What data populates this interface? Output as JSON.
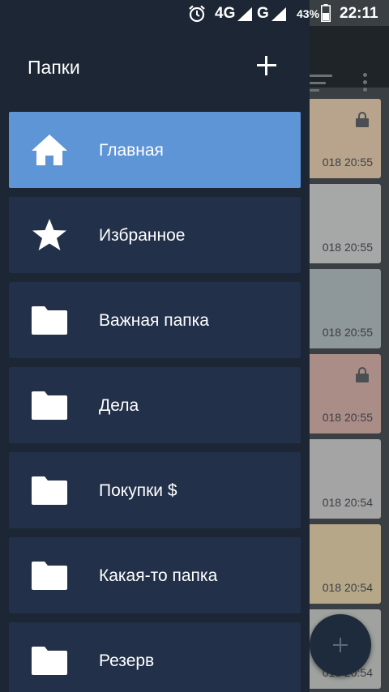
{
  "status_bar": {
    "network_1": "4G",
    "network_2": "G",
    "battery": "43%",
    "time": "22:11"
  },
  "drawer": {
    "title": "Папки",
    "folders": [
      {
        "label": "Главная",
        "icon": "home-icon",
        "active": true
      },
      {
        "label": "Избранное",
        "icon": "star-icon",
        "active": false
      },
      {
        "label": "Важная папка",
        "icon": "folder-icon",
        "active": false
      },
      {
        "label": "Дела",
        "icon": "folder-icon",
        "active": false
      },
      {
        "label": "Покупки $",
        "icon": "folder-icon",
        "active": false
      },
      {
        "label": "Какая-то папка",
        "icon": "folder-icon",
        "active": false
      },
      {
        "label": "Резерв",
        "icon": "folder-icon",
        "active": false
      }
    ]
  },
  "background_notes": [
    {
      "date": "018   20:55",
      "color": "#b8a48c",
      "locked": true
    },
    {
      "date": "018   20:55",
      "color": "#a6a7a7",
      "locked": false
    },
    {
      "date": "018   20:55",
      "color": "#8e979a",
      "locked": false
    },
    {
      "date": "018   20:55",
      "color": "#ab8d88",
      "locked": true
    },
    {
      "date": "018   20:54",
      "color": "#a4a4a4",
      "locked": false
    },
    {
      "date": "018   20:54",
      "color": "#b6a789",
      "locked": false
    },
    {
      "date": "018   20:54",
      "color": "#9fa29f",
      "locked": false
    }
  ],
  "colors": {
    "drawer_bg": "#1c2634",
    "item_bg": "#223049",
    "active_item_bg": "#5e95d6"
  }
}
